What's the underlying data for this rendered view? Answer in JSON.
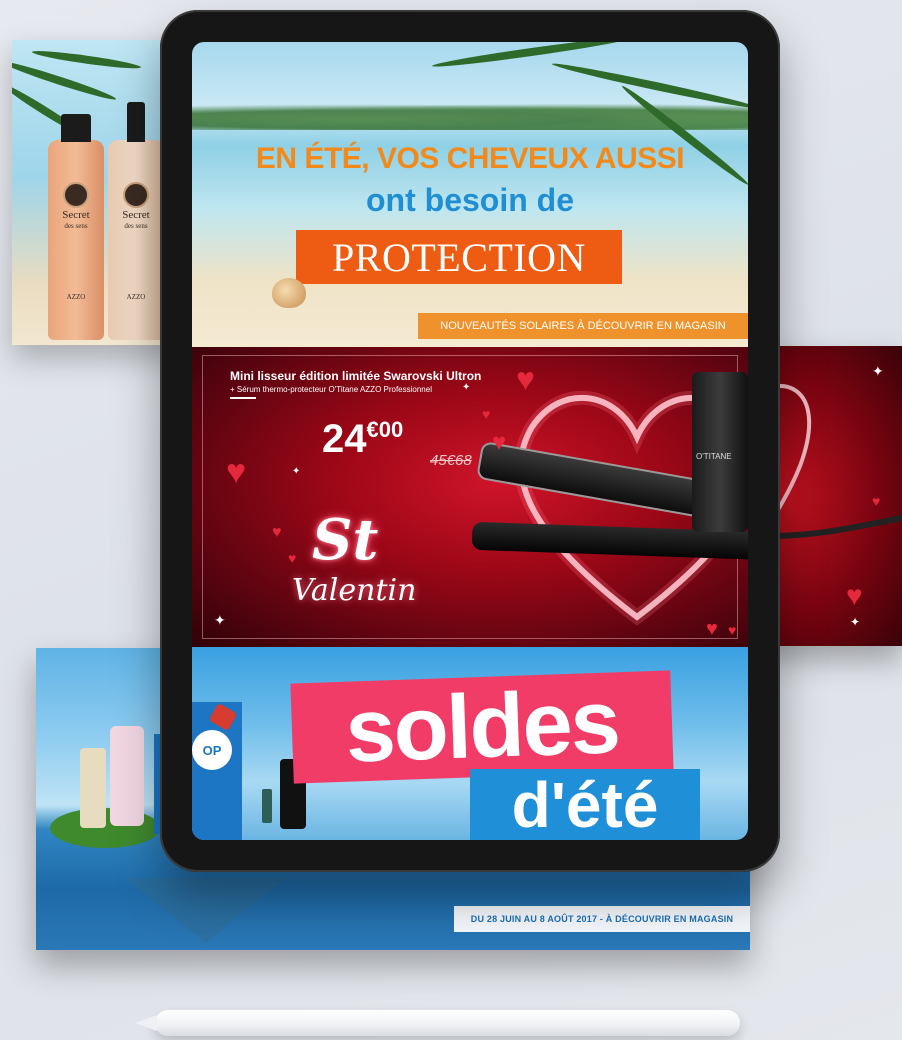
{
  "summer_back": {
    "bottle1": {
      "brand": "Secret",
      "sub": "des sens",
      "maker": "AZZO"
    },
    "bottle2": {
      "brand": "Secret",
      "sub": "des sens",
      "maker": "AZZO"
    }
  },
  "summer": {
    "line1": "EN ÉTÉ, VOS CHEVEUX AUSSI",
    "line2": "ont besoin de",
    "line3": "PROTECTION",
    "tag": "NOUVEAUTÉS SOLAIRES À DÉCOUVRIR EN MAGASIN"
  },
  "valentine": {
    "title": "Mini lisseur édition limitée Swarovski Ultron",
    "subtitle": "+ Sérum thermo-protecteur O'Titane AZZO Professionnel",
    "price_main": "24",
    "price_cents": "€00",
    "price_old": "45€68",
    "st": "St",
    "valentin": "Valentin",
    "product_brand": "O'TITANE"
  },
  "soldes": {
    "word1": "soldes",
    "word2": "d'été",
    "bag_label": "OP",
    "dates": "DU 28 JUIN AU 8 AOÛT 2017 - À DÉCOUVRIR EN MAGASIN"
  },
  "colors": {
    "orange": "#f28a1b",
    "blue": "#1f8ed3",
    "protection_bg": "#ee5b12",
    "valentine_red": "#9a0716",
    "soldes_pink": "#f03c67",
    "soldes_blue": "#1f8fd8"
  }
}
